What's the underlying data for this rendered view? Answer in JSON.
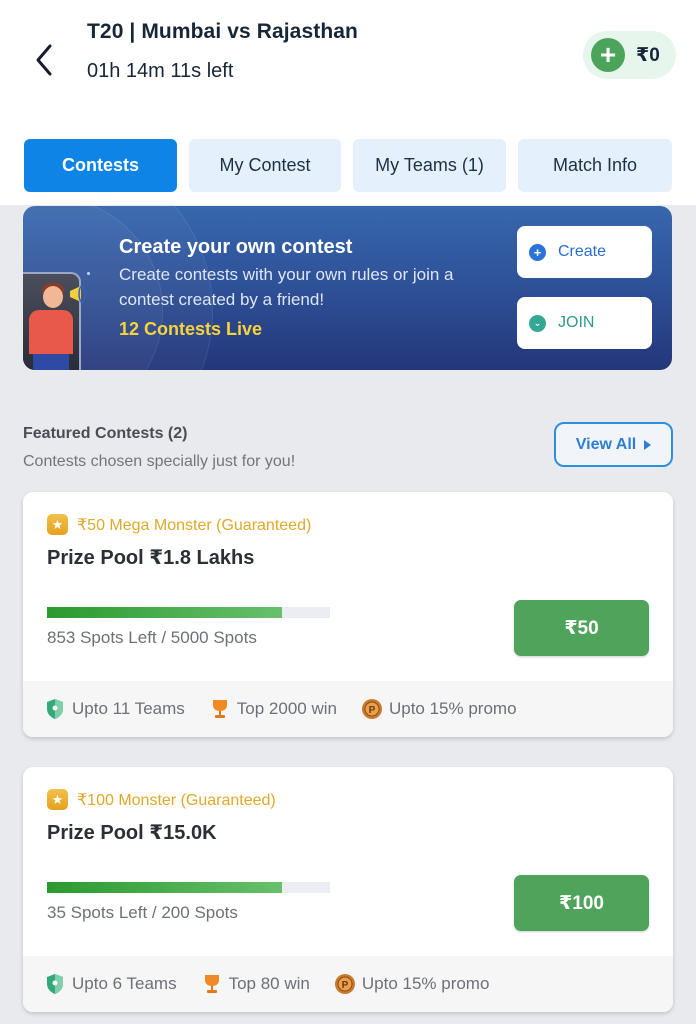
{
  "header": {
    "title": "T20 | Mumbai vs Rajasthan",
    "timer": "01h 14m 11s left",
    "wallet_balance": "₹0",
    "icons": {
      "back": "chevron-left-icon",
      "add_money": "plus-icon"
    }
  },
  "tabs": [
    {
      "label": "Contests",
      "active": true
    },
    {
      "label": "My Contest",
      "active": false
    },
    {
      "label": "My Teams (1)",
      "active": false
    },
    {
      "label": "Match Info",
      "active": false
    }
  ],
  "banner": {
    "title": "Create your own contest",
    "description": "Create contests with your own rules or join a contest created by a friend!",
    "live_count": "12 Contests Live",
    "create_label": "Create",
    "join_label": "JOIN"
  },
  "featured": {
    "title": "Featured Contests (2)",
    "subtitle": "Contests chosen specially just for you!",
    "view_all_label": "View All"
  },
  "contests": [
    {
      "tag": "₹50 Mega Monster (Guaranteed)",
      "prize_pool": "Prize Pool ₹1.8 Lakhs",
      "spots_text": "853 Spots Left / 5000 Spots",
      "fill_fraction": 0.83,
      "entry_fee": "₹50",
      "features": [
        "Upto 11 Teams",
        "Top 2000 win",
        "Upto 15% promo"
      ]
    },
    {
      "tag": "₹100 Monster (Guaranteed)",
      "prize_pool": "Prize Pool ₹15.0K",
      "spots_text": "35 Spots Left / 200 Spots",
      "fill_fraction": 0.83,
      "entry_fee": "₹100",
      "features": [
        "Upto 6 Teams",
        "Top 80 win",
        "Upto 15% promo"
      ]
    }
  ],
  "colors": {
    "primary_blue": "#0d84e6",
    "join_green": "#4fa35a",
    "tag_gold": "#e0a928",
    "live_yellow": "#f7d43c"
  }
}
